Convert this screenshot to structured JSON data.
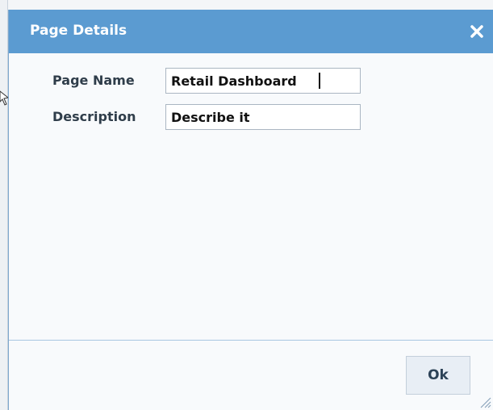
{
  "dialog": {
    "title": "Page Details",
    "close_icon": "close-icon"
  },
  "form": {
    "page_name": {
      "label": "Page Name",
      "value": "Retail Dashboard"
    },
    "description": {
      "label": "Description",
      "value": "Describe it"
    }
  },
  "footer": {
    "ok_label": "Ok"
  },
  "colors": {
    "titlebar": "#5b9bd1",
    "title_text": "#ffffff",
    "dialog_bg": "#f8fafc",
    "separator": "#a9c6e2",
    "ok_button_bg": "#e8eef5"
  }
}
